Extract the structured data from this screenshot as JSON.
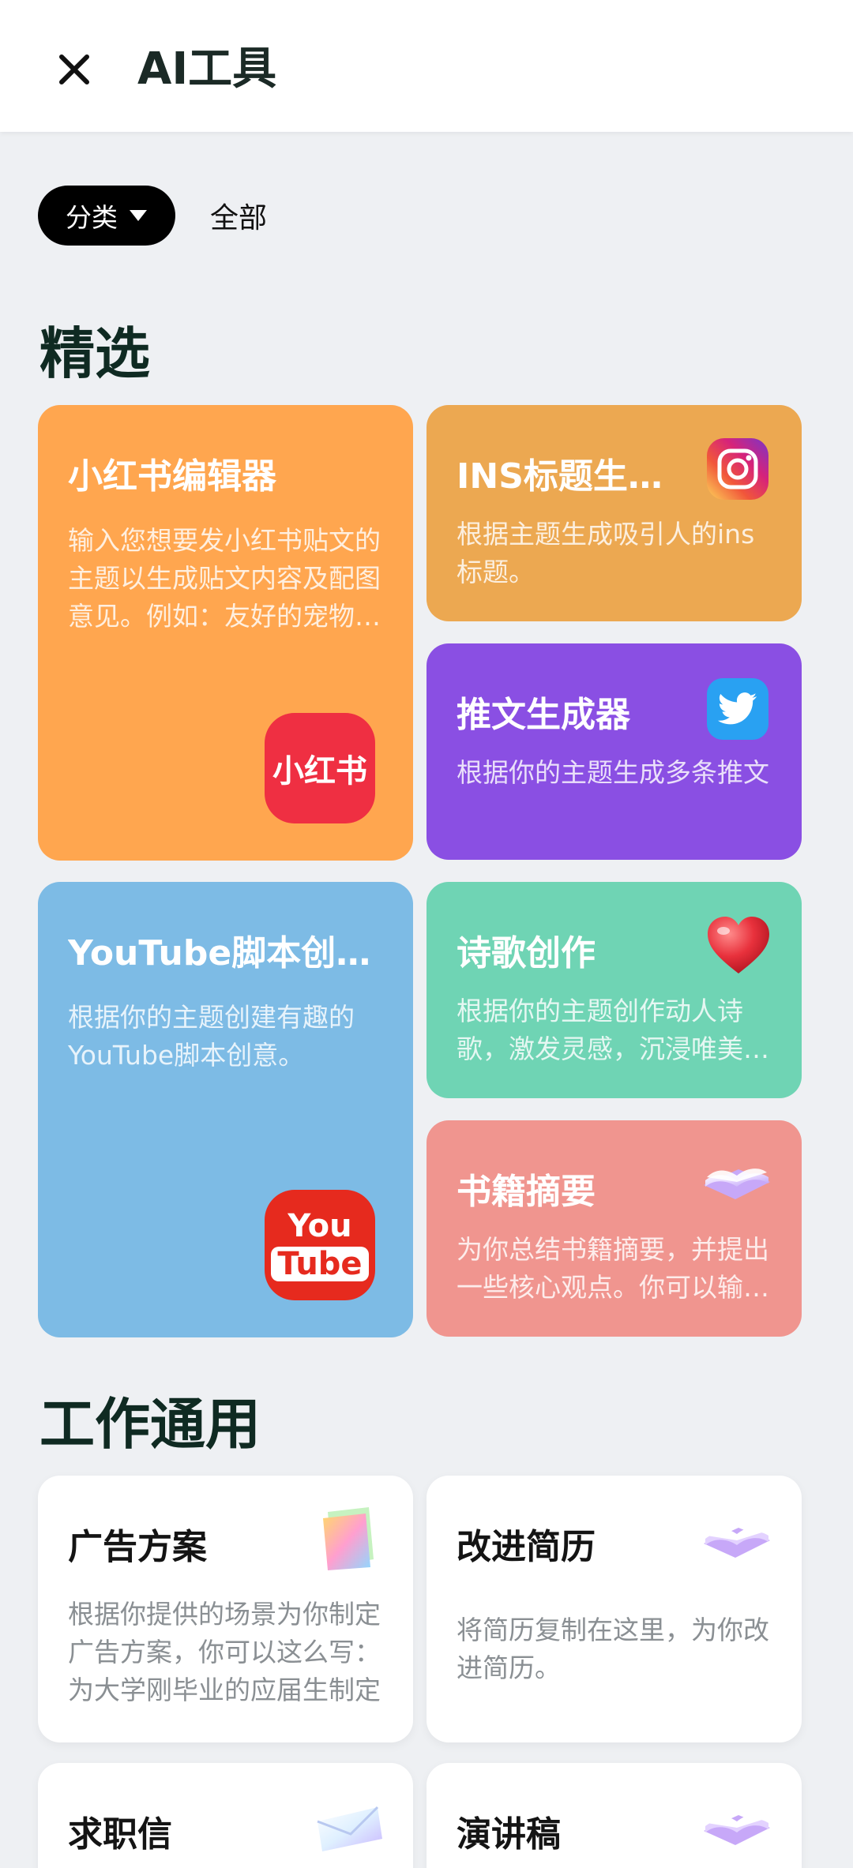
{
  "header": {
    "title": "AI工具"
  },
  "filters": {
    "category_label": "分类",
    "all_label": "全部"
  },
  "sections": {
    "featured": "精选",
    "work": "工作通用"
  },
  "featured_cards": [
    {
      "title": "小红书编辑器",
      "desc": "输入您想要发小红书贴文的主题以生成贴文内容及配图意见。例如：友好的宠物店推荐",
      "logo": "小红书",
      "color": "#ffa64f"
    },
    {
      "title": "INS标题生成器",
      "desc": "根据主题生成吸引人的ins标题。",
      "color": "#eca851"
    },
    {
      "title": "推文生成器",
      "desc": "根据你的主题生成多条推文",
      "color": "#8a4fe3"
    },
    {
      "title": "YouTube脚本创作器",
      "desc": "根据你的主题创建有趣的YouTube脚本创意。",
      "logo_top": "You",
      "logo_bottom": "Tube",
      "color": "#7dbbe5"
    },
    {
      "title": "诗歌创作",
      "desc": "根据你的主题创作动人诗歌，激发灵感，沉浸唯美意境",
      "color": "#6fd4b4"
    },
    {
      "title": "书籍摘要",
      "desc": "为你总结书籍摘要，并提出一些核心观点。你可以输入书名",
      "color": "#f0958f"
    }
  ],
  "work_cards": [
    {
      "title": "广告方案",
      "desc": "根据你提供的场景为你制定广告方案，你可以这么写：为大学刚毕业的应届生制定"
    },
    {
      "title": "改进简历",
      "desc": "将简历复制在这里，为你改进简历。"
    },
    {
      "title": "求职信",
      "desc": ""
    },
    {
      "title": "演讲稿",
      "desc": ""
    }
  ]
}
